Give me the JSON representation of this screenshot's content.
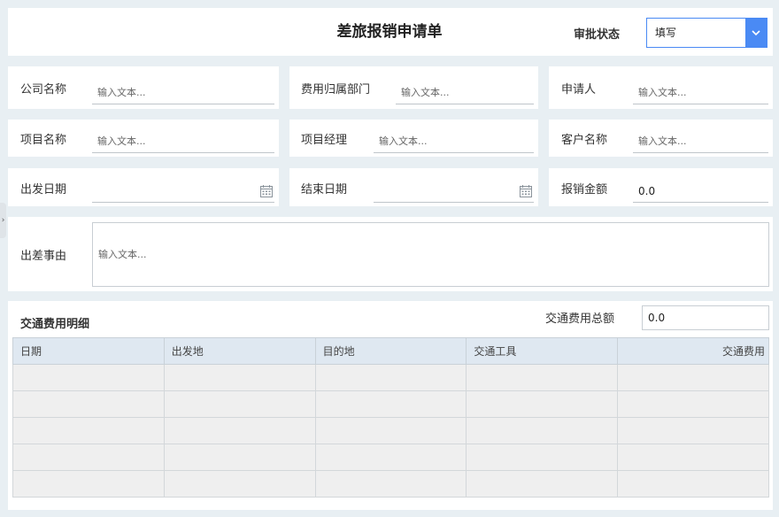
{
  "header": {
    "title": "差旅报销申请单",
    "status_label": "审批状态",
    "status_value": "填写"
  },
  "form": {
    "company_label": "公司名称",
    "company_placeholder": "输入文本...",
    "department_label": "费用归属部门",
    "department_placeholder": "输入文本...",
    "applicant_label": "申请人",
    "applicant_placeholder": "输入文本...",
    "project_label": "项目名称",
    "project_placeholder": "输入文本...",
    "manager_label": "项目经理",
    "manager_placeholder": "输入文本...",
    "customer_label": "客户名称",
    "customer_placeholder": "输入文本...",
    "start_date_label": "出发日期",
    "end_date_label": "结束日期",
    "amount_label": "报销金额",
    "amount_value": "0.0",
    "reason_label": "出差事由",
    "reason_placeholder": "输入文本..."
  },
  "transport": {
    "section_title": "交通费用明细",
    "total_label": "交通费用总额",
    "total_value": "0.0",
    "columns": [
      "日期",
      "出发地",
      "目的地",
      "交通工具",
      "交通费用"
    ],
    "rows": [
      [
        "",
        "",
        "",
        "",
        ""
      ],
      [
        "",
        "",
        "",
        "",
        ""
      ],
      [
        "",
        "",
        "",
        "",
        ""
      ],
      [
        "",
        "",
        "",
        "",
        ""
      ],
      [
        "",
        "",
        "",
        "",
        ""
      ]
    ]
  },
  "icons": {
    "calendar": "calendar-icon",
    "dropdown": "chevron-down-icon",
    "expand": "chevron-right-icon"
  },
  "colors": {
    "accent": "#4a8af4",
    "header_row": "#dfe8f1",
    "empty_row": "#efefef",
    "background": "#e8eff3"
  }
}
